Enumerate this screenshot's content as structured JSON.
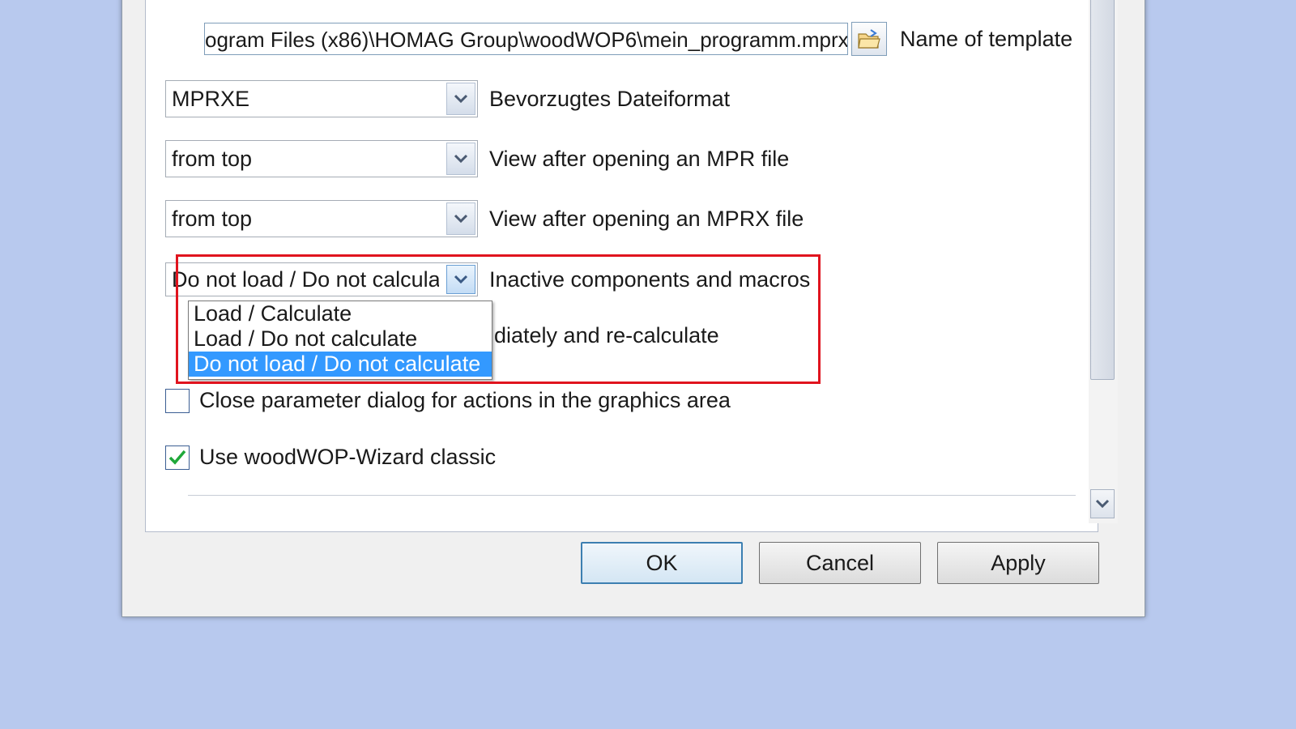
{
  "template": {
    "path_value": "ogram Files (x86)\\HOMAG Group\\woodWOP6\\mein_programm.mprx",
    "label": "Name of template",
    "browse_icon": "folder-open-icon"
  },
  "file_format": {
    "value": "MPRXE",
    "label": "Bevorzugtes Dateiformat"
  },
  "mpr_view": {
    "value": "from top",
    "label": "View after opening an MPR file"
  },
  "mprx_view": {
    "value": "from top",
    "label": "View after opening an MPRX file"
  },
  "inactive_components": {
    "value": "Do not load / Do not calculat",
    "label": "Inactive components and macros",
    "options": [
      "Load / Calculate",
      "Load / Do not calculate",
      "Do not load / Do not calculate"
    ],
    "selected_index": 2
  },
  "hidden_row_partial_label": "diately and re-calculate",
  "close_dialog_checkbox": {
    "label": "Close parameter dialog for actions in the graphics area",
    "checked": false
  },
  "wizard_checkbox": {
    "label": "Use woodWOP-Wizard classic",
    "checked": true
  },
  "buttons": {
    "ok": "OK",
    "cancel": "Cancel",
    "apply": "Apply"
  },
  "colors": {
    "highlight": "#e0141e",
    "selection": "#3399ff",
    "background": "#b8c9ee"
  }
}
